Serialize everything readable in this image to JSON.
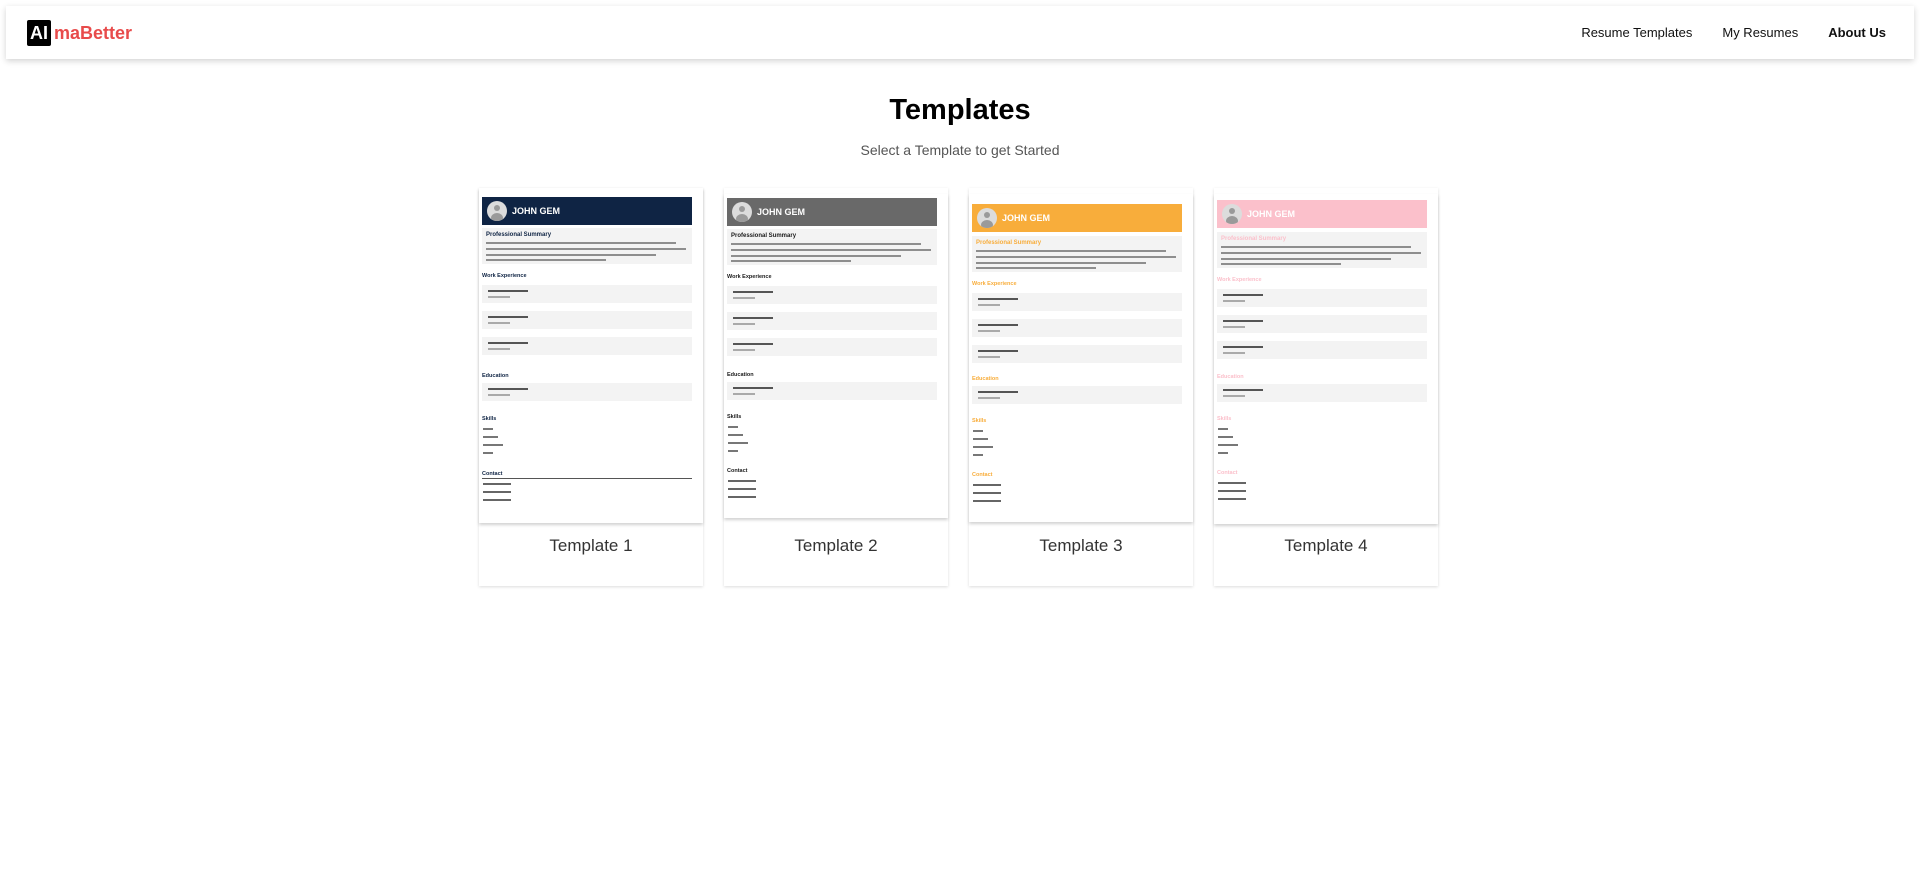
{
  "brand": {
    "mark": "AI",
    "name": "maBetter"
  },
  "nav": {
    "items": [
      "Resume Templates",
      "My Resumes",
      "About Us"
    ],
    "active": "About Us"
  },
  "page": {
    "title": "Templates",
    "subtitle": "Select a Template to get Started"
  },
  "templates": [
    {
      "title": "Template 1",
      "name": "JOHN GEM",
      "accent": "#0f2444",
      "header_text": "#ffffff",
      "sections": {
        "summary": "Professional Summary",
        "work": "Work Experience",
        "education": "Education",
        "skills": "Skills",
        "contact": "Contact"
      }
    },
    {
      "title": "Template 2",
      "name": "JOHN GEM",
      "accent": "#696969",
      "header_text": "#ffffff",
      "sections": {
        "summary": "Professional Summary",
        "work": "Work Experience",
        "education": "Education",
        "skills": "Skills",
        "contact": "Contact"
      }
    },
    {
      "title": "Template 3",
      "name": "JOHN GEM",
      "accent": "#f8ad3b",
      "header_text": "#ffffff",
      "sections": {
        "summary": "Professional Summary",
        "work": "Work Experience",
        "education": "Education",
        "skills": "Skills",
        "contact": "Contact"
      }
    },
    {
      "title": "Template 4",
      "name": "JOHN GEM",
      "accent": "#fbc0cb",
      "header_text": "#ffffff",
      "sections": {
        "summary": "Professional Summary",
        "work": "Work Experience",
        "education": "Education",
        "skills": "Skills",
        "contact": "Contact"
      }
    }
  ],
  "colors": {
    "brand_red": "#e84b4b",
    "section_label_default": "#1a1a1a"
  }
}
